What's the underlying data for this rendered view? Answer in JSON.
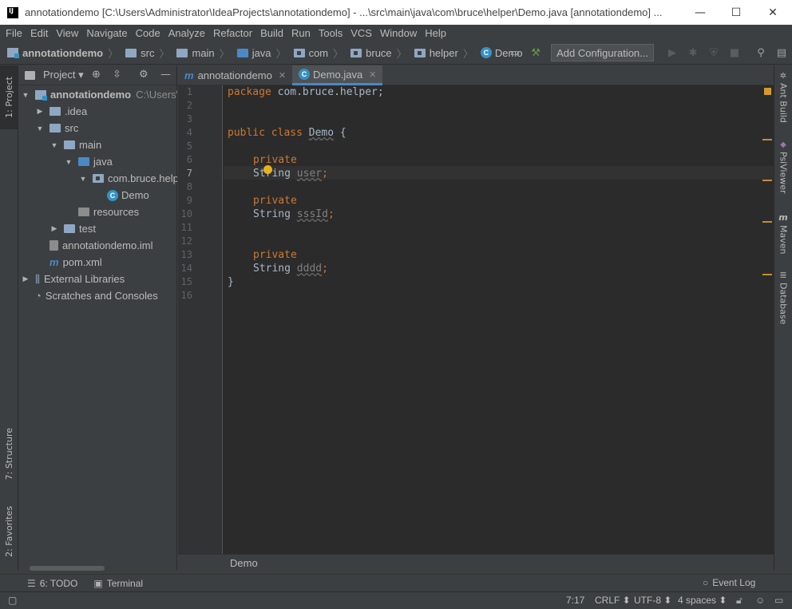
{
  "window": {
    "title": "annotationdemo [C:\\Users\\Administrator\\IdeaProjects\\annotationdemo] - ...\\src\\main\\java\\com\\bruce\\helper\\Demo.java [annotationdemo] ...",
    "minimize": "—",
    "maximize": "☐",
    "close": "✕"
  },
  "menu": [
    "File",
    "Edit",
    "View",
    "Navigate",
    "Code",
    "Analyze",
    "Refactor",
    "Build",
    "Run",
    "Tools",
    "VCS",
    "Window",
    "Help"
  ],
  "navbar": {
    "crumbs": [
      "annotationdemo",
      "src",
      "main",
      "java",
      "com",
      "bruce",
      "helper",
      "Demo"
    ],
    "add_configuration": "Add Configuration..."
  },
  "left_stripe": {
    "project": "1: Project",
    "structure": "7: Structure",
    "favorites": "2: Favorites"
  },
  "project_panel": {
    "title": "Project",
    "tree": [
      {
        "label": "annotationdemo",
        "sub": "C:\\Users\\"
      },
      {
        "label": ".idea"
      },
      {
        "label": "src"
      },
      {
        "label": "main"
      },
      {
        "label": "java"
      },
      {
        "label": "com.bruce.helper"
      },
      {
        "label": "Demo"
      },
      {
        "label": "resources"
      },
      {
        "label": "test"
      },
      {
        "label": "annotationdemo.iml"
      },
      {
        "label": "pom.xml"
      },
      {
        "label": "External Libraries"
      },
      {
        "label": "Scratches and Consoles"
      }
    ]
  },
  "editor_tabs": [
    {
      "label": "annotationdemo",
      "icon": "maven-module-icon"
    },
    {
      "label": "Demo.java",
      "icon": "class-icon"
    }
  ],
  "editor": {
    "line_numbers": [
      "1",
      "2",
      "3",
      "4",
      "5",
      "6",
      "7",
      "8",
      "9",
      "10",
      "11",
      "12",
      "13",
      "14",
      "15",
      "16"
    ],
    "current_line": "7",
    "code": {
      "l1_kw": "package",
      "l1_rest": " com.bruce.helper;",
      "l4_kw": "public class",
      "l4_name": "Demo",
      "l4_rest": " {",
      "l6_kw": "private",
      "l7_type": "String ",
      "l7_name": "user",
      "l7_end": ";",
      "l9_kw": "private",
      "l10_type": "String ",
      "l10_name": "sssId",
      "l10_end": ";",
      "l13_kw": "private",
      "l14_type": "String ",
      "l14_name": "dddd",
      "l14_end": ";",
      "l15": "}"
    },
    "breadcrumb": "Demo"
  },
  "right_stripe": [
    "Ant Build",
    "PsiViewer",
    "Maven",
    "Database"
  ],
  "bottom_tools": [
    {
      "label": "6: TODO",
      "icon": "todo-list-icon"
    },
    {
      "label": "Terminal",
      "icon": "terminal-icon"
    }
  ],
  "event_log": "Event Log",
  "status": {
    "position": "7:17",
    "line_separator": "CRLF",
    "encoding": "UTF-8",
    "indent": "4 spaces"
  },
  "colors": {
    "editor_bg": "#2b2b2b",
    "keyword": "#cc7832",
    "text": "#a9b7c6",
    "accent": "#4a88c7"
  }
}
